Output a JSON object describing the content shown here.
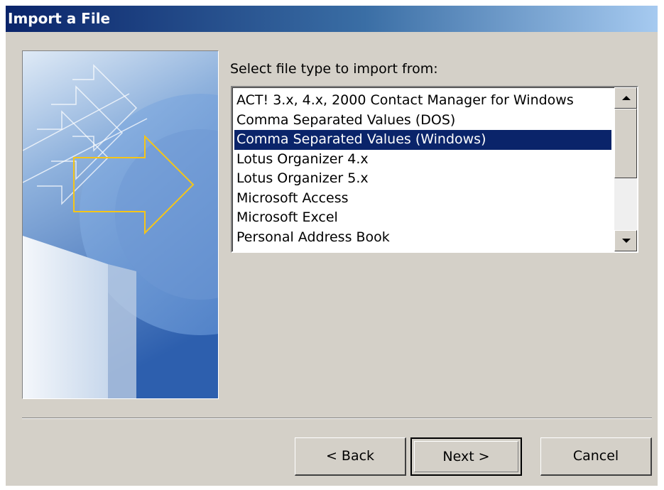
{
  "window": {
    "title": "Import a File"
  },
  "wizard": {
    "prompt": "Select file type to import from:",
    "file_types": [
      {
        "label": "ACT! 3.x, 4.x, 2000 Contact Manager for Windows",
        "selected": false
      },
      {
        "label": "Comma Separated Values (DOS)",
        "selected": false
      },
      {
        "label": "Comma Separated Values (Windows)",
        "selected": true
      },
      {
        "label": "Lotus Organizer 4.x",
        "selected": false
      },
      {
        "label": "Lotus Organizer 5.x",
        "selected": false
      },
      {
        "label": "Microsoft Access",
        "selected": false
      },
      {
        "label": "Microsoft Excel",
        "selected": false
      },
      {
        "label": "Personal Address Book",
        "selected": false
      }
    ]
  },
  "buttons": {
    "back": "< Back",
    "next": "Next >",
    "cancel": "Cancel"
  },
  "icons": {
    "scroll_up": "scroll-up-arrow-icon",
    "scroll_down": "scroll-down-arrow-icon",
    "wizard_art": "wizard-arrow-illustration"
  },
  "colors": {
    "selection": "#0a246a",
    "dialog_face": "#d4d0c8",
    "arrow_accent": "#f5c518"
  }
}
